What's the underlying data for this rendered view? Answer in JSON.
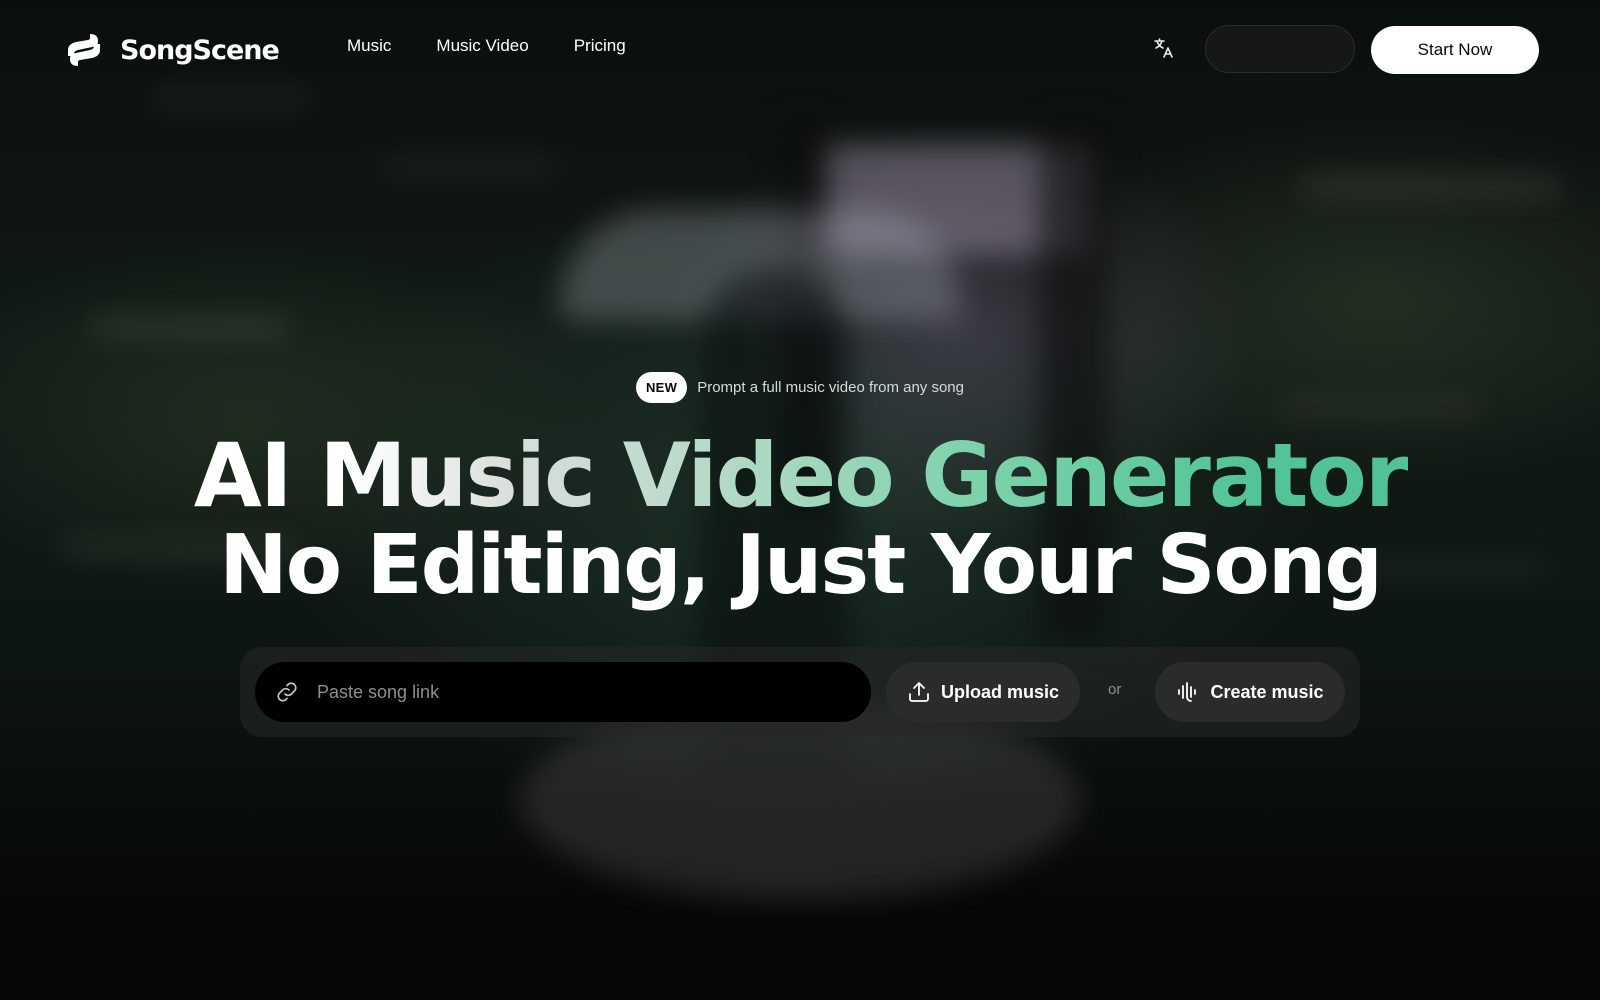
{
  "brand": {
    "name": "SongScene"
  },
  "nav": {
    "items": [
      {
        "label": "Music"
      },
      {
        "label": "Music Video"
      },
      {
        "label": "Pricing"
      }
    ]
  },
  "header": {
    "translate_icon": "translate-icon",
    "secondary_button_label": "",
    "start_button_label": "Start Now"
  },
  "hero": {
    "badge": "NEW",
    "announcement": "Prompt a full music video from any song",
    "title_line1": "AI Music Video Generator",
    "title_line2": "No Editing, Just Your Song",
    "title_gradient_colors": [
      "#ffffff",
      "#4cbf92"
    ]
  },
  "actions": {
    "link_placeholder": "Paste song link",
    "link_icon": "link-icon",
    "upload_label": "Upload music",
    "upload_icon": "upload-icon",
    "or_text": "or",
    "create_label": "Create music",
    "create_icon": "waveform-icon"
  },
  "colors": {
    "accent": "#4cbf92",
    "background": "#050806",
    "button_primary_bg": "#ffffff"
  }
}
